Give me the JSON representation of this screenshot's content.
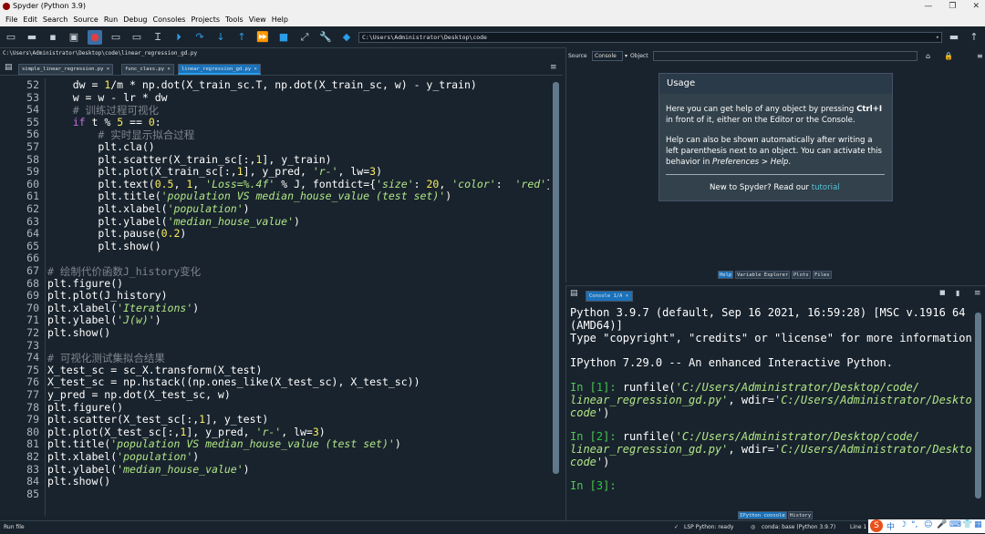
{
  "window": {
    "title": "Spyder (Python 3.9)",
    "controls": [
      "—",
      "❐",
      "✕"
    ]
  },
  "menu": [
    "File",
    "Edit",
    "Search",
    "Source",
    "Run",
    "Debug",
    "Consoles",
    "Projects",
    "Tools",
    "View",
    "Help"
  ],
  "toolbar": {
    "working_dir": "C:\\Users\\Administrator\\Desktop\\code"
  },
  "editor": {
    "file_path": "C:\\Users\\Administrator\\Desktop\\code\\linear_regression_gd.py",
    "tabs": [
      "simple_linear_regression.py ×",
      "func_class.py ×",
      "linear_regression_gd.py ×"
    ],
    "line_numbers": [
      "52",
      "53",
      "54",
      "55",
      "56",
      "57",
      "58",
      "59",
      "60",
      "61",
      "62",
      "63",
      "64",
      "65",
      "66",
      "67",
      "68",
      "69",
      "70",
      "71",
      "72",
      "73",
      "74",
      "75",
      "76",
      "77",
      "78",
      "79",
      "80",
      "81",
      "82",
      "83",
      "84",
      "85"
    ]
  },
  "help": {
    "source_label": "Source",
    "source_value": "Console",
    "object_label": "Object",
    "title": "Usage",
    "p1_a": "Here you can get help of any object by pressing ",
    "p1_key": "Ctrl+I",
    "p1_b": "in front of it, either on the Editor or the Console.",
    "p2_l1": "Help can also be shown automatically after writing a",
    "p2_l2": "left parenthesis next to an object. You can activate this",
    "p2_l3a": "behavior in ",
    "p2_l3b": "Preferences > Help",
    "p2_l3c": ".",
    "footer_a": "New to Spyder? Read our ",
    "footer_link": "tutorial",
    "panel_tabs": [
      "Help",
      "Variable Explorer",
      "Plots",
      "Files"
    ]
  },
  "console": {
    "tab": "Console 1/A ×",
    "panel_tabs": [
      "IPython console",
      "History"
    ]
  },
  "status": {
    "left": "Run file",
    "lsp": "LSP Python: ready",
    "conda": "conda: base (Python 3.9.7)",
    "line": "Line 1"
  }
}
